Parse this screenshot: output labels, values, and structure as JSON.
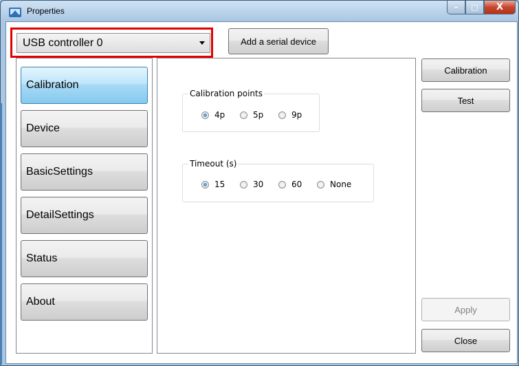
{
  "window": {
    "title": "Properties",
    "min": "–",
    "max": "□",
    "close": "X"
  },
  "device_select": {
    "value": "USB controller 0"
  },
  "add_serial_label": "Add a serial device",
  "nav": [
    "Calibration",
    "Device",
    "BasicSettings",
    "DetailSettings",
    "Status",
    "About"
  ],
  "active_nav": "Calibration",
  "calibration_points": {
    "label": "Calibration points",
    "options": [
      "4p",
      "5p",
      "9p"
    ],
    "selected": "4p"
  },
  "timeout": {
    "label": "Timeout (s)",
    "options": [
      "15",
      "30",
      "60",
      "None"
    ],
    "selected": "15"
  },
  "actions": {
    "calibration": "Calibration",
    "test": "Test",
    "apply": "Apply",
    "close": "Close"
  }
}
